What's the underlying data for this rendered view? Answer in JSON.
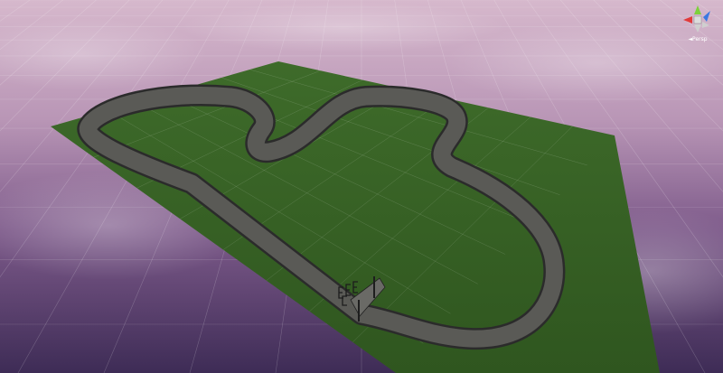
{
  "scene_view": {
    "colors": {
      "sky_top": "#d6b8cc",
      "sky_horizon": "#b996b6",
      "sky_low": "#7d5a8a",
      "sky_bottom": "#3e2c56",
      "grass": "#3e6b2a",
      "grass_dark": "#2f561f",
      "track": "#5a5a56",
      "track_edge": "#2b2b2b",
      "grid_line": "#ffffff"
    },
    "gizmo": {
      "projection_label": "◄Persp",
      "x_axis_color": "#e23a3a",
      "y_axis_color": "#7dd13b",
      "z_axis_color": "#3a78e2"
    }
  }
}
